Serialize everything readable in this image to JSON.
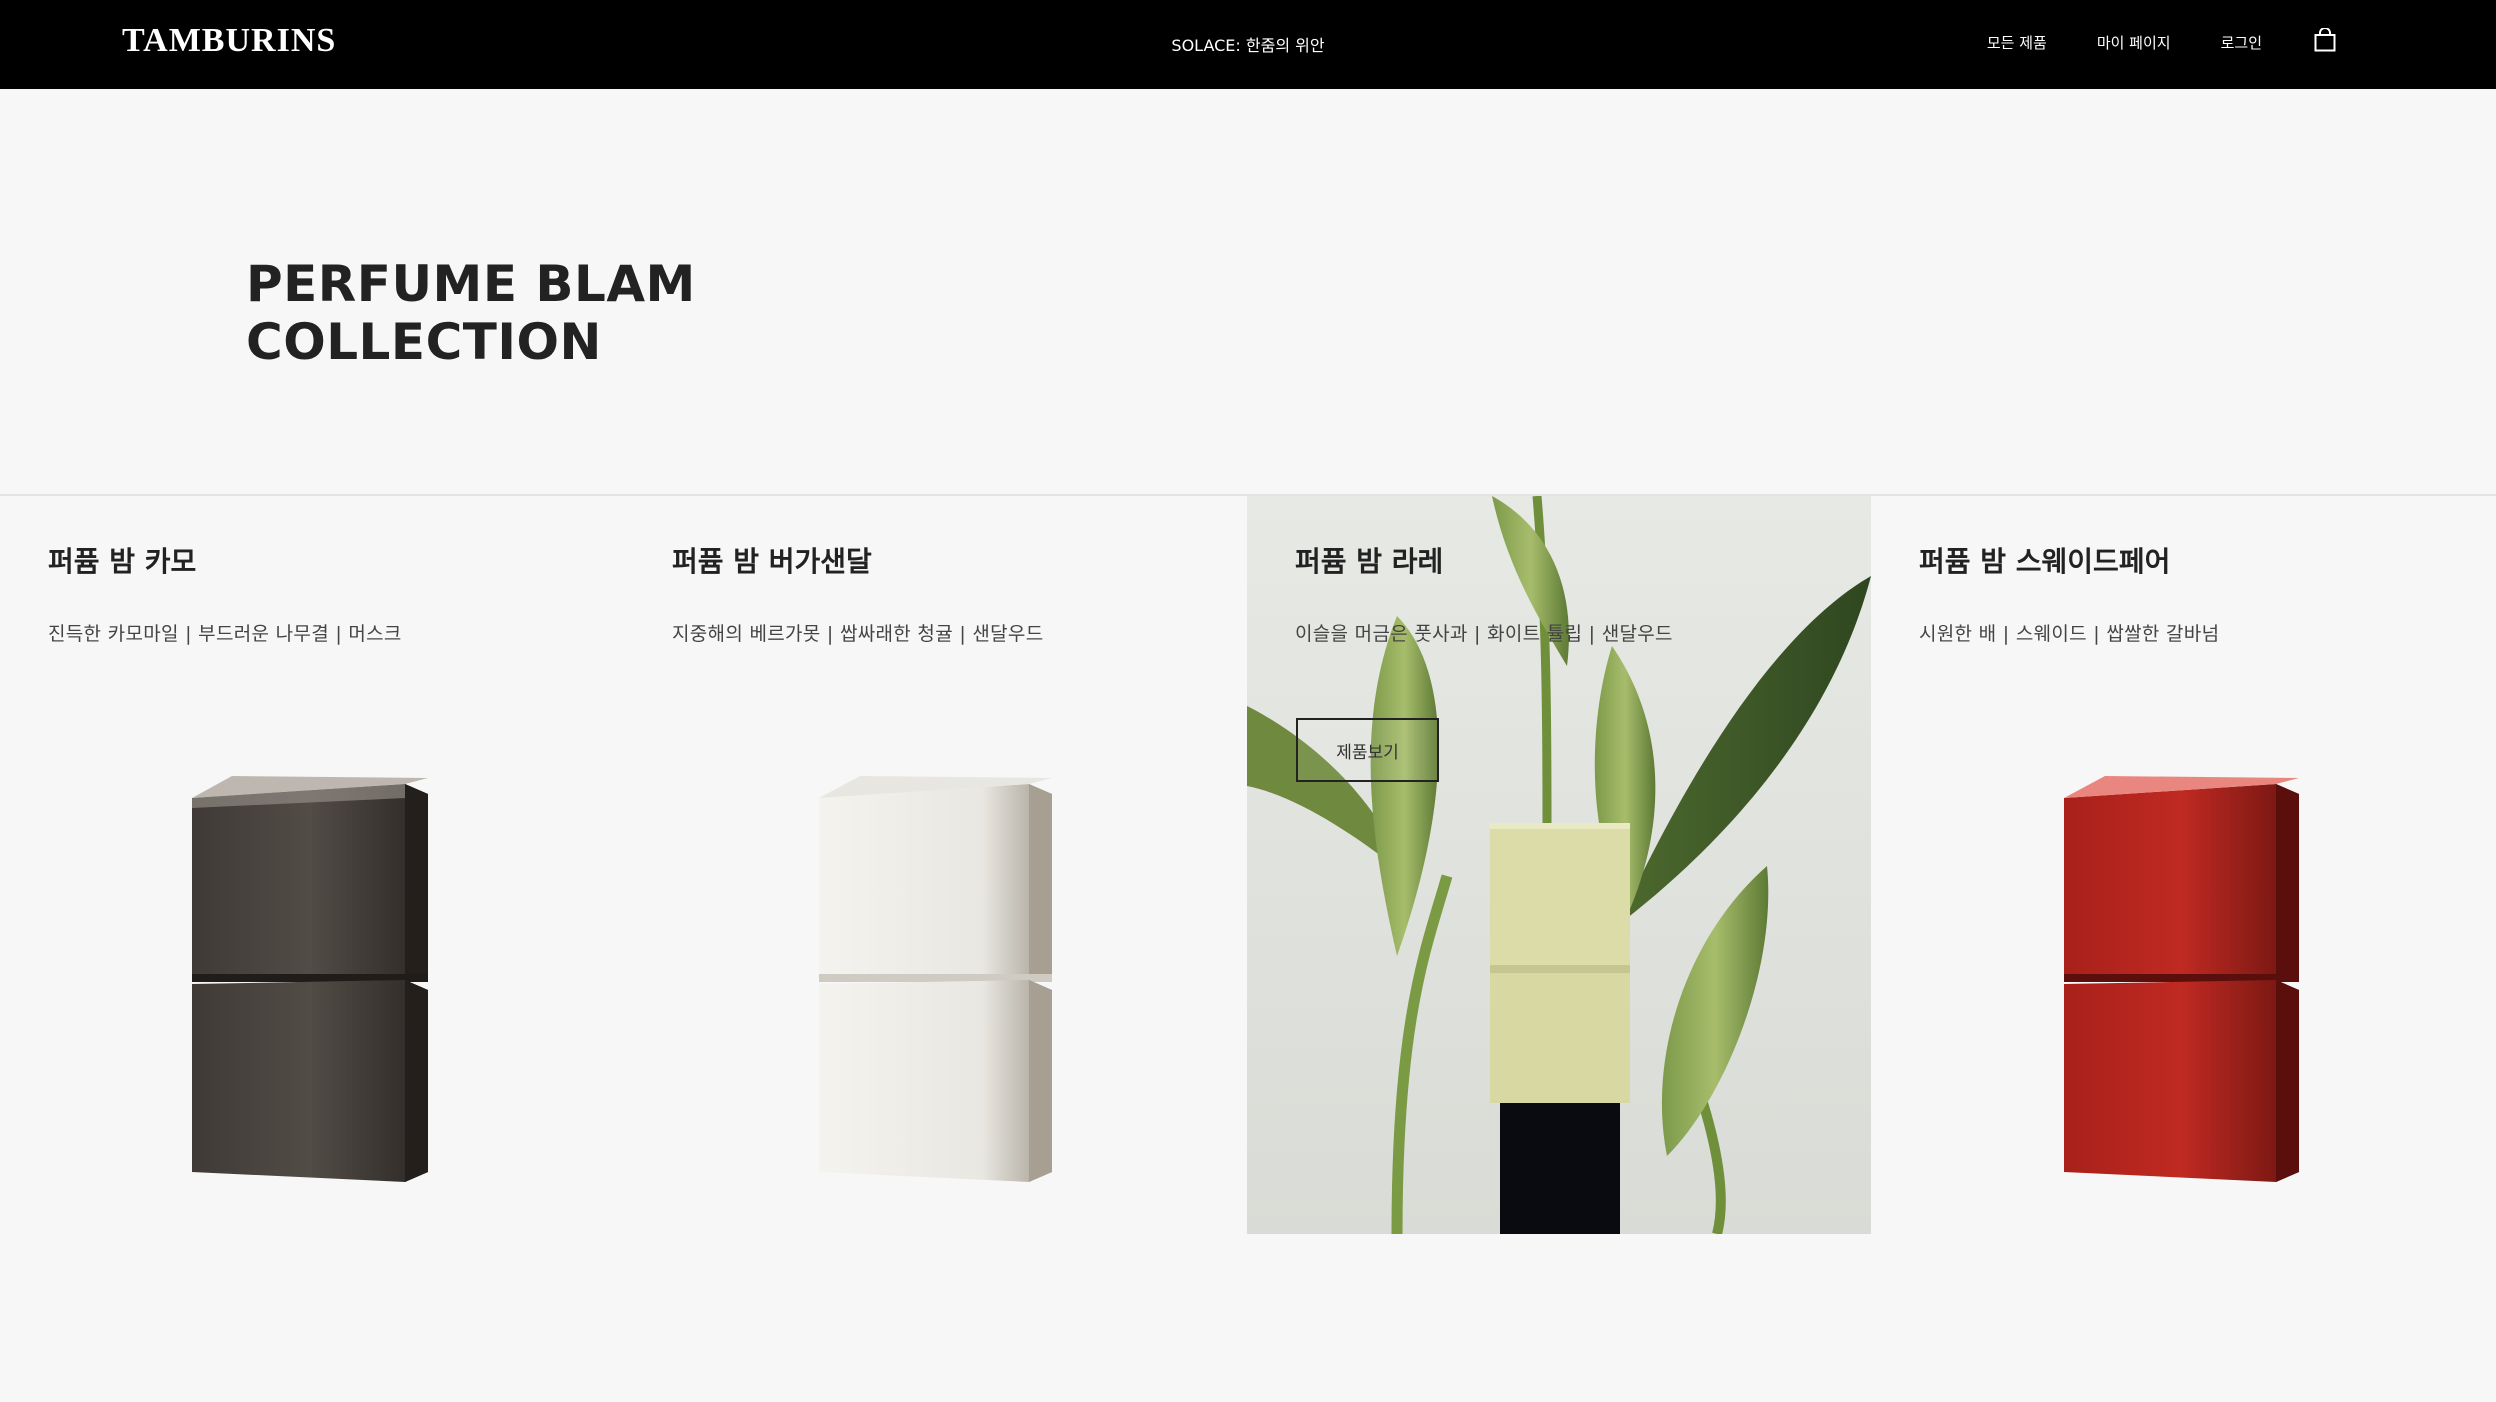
{
  "header": {
    "brand": "TAMBURINS",
    "promo": "SOLACE: 한줌의 위안",
    "nav": [
      "모든 제품",
      "마이 페이지",
      "로그인"
    ],
    "cart_icon": "shopping-bag-icon"
  },
  "hero": {
    "title": "PERFUME BLAM\nCOLLECTION"
  },
  "products": [
    {
      "name": "퍼퓸 밤 카모",
      "notes": "진득한 카모마일 | 부드러운 나무결 | 머스크",
      "color": "#4a4540"
    },
    {
      "name": "퍼퓸 밤 버가샌달",
      "notes": "지중해의 베르가못 | 쌉싸래한 청귤 | 샌달우드",
      "color": "#eeede8"
    },
    {
      "name": "퍼퓸 밤 라레",
      "notes": "이슬을 머금은 풋사과 | 화이트 튤립 | 샌달우드",
      "color": "#dbdcaa",
      "cta": "제품보기"
    },
    {
      "name": "퍼퓸 밤 스웨이드페어",
      "notes": "시원한 배 | 스웨이드 | 쌉쌀한 갈바넘",
      "color": "#b0211a"
    }
  ]
}
